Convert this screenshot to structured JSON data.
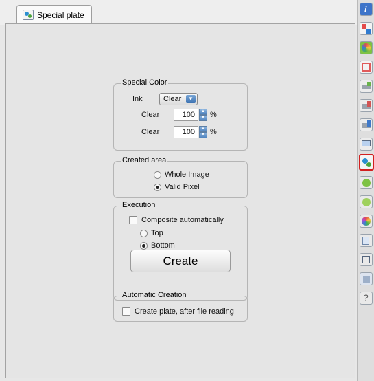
{
  "tab": {
    "label": "Special plate",
    "icon": "special-plate-icon"
  },
  "special_color": {
    "legend": "Special Color",
    "ink_label": "Ink",
    "ink_value": "Clear",
    "rows": [
      {
        "label": "Clear",
        "value": "100",
        "unit": "%"
      },
      {
        "label": "Clear",
        "value": "100",
        "unit": "%"
      }
    ]
  },
  "created_area": {
    "legend": "Created area",
    "options": [
      {
        "label": "Whole Image",
        "selected": false
      },
      {
        "label": "Valid Pixel",
        "selected": true
      }
    ]
  },
  "execution": {
    "legend": "Execution",
    "composite_label": "Composite automatically",
    "composite_checked": false,
    "options": [
      {
        "label": "Top",
        "selected": false
      },
      {
        "label": "Bottom",
        "selected": true
      }
    ],
    "create_label": "Create"
  },
  "automatic_creation": {
    "legend": "Automatic Creation",
    "checkbox_label": "Create plate, after file reading",
    "checked": false
  },
  "toolbar": {
    "icons": [
      "info-icon",
      "layout-icon",
      "color-wheel-icon",
      "frame-icon",
      "print-icon",
      "cut-icon",
      "print-settings-icon",
      "monitor-icon",
      "special-plate-icon",
      "layer-icon",
      "adjust-icon",
      "palette-icon",
      "copy-icon",
      "split-icon",
      "delete-icon",
      "help-icon"
    ],
    "selected": "special-plate-icon"
  }
}
